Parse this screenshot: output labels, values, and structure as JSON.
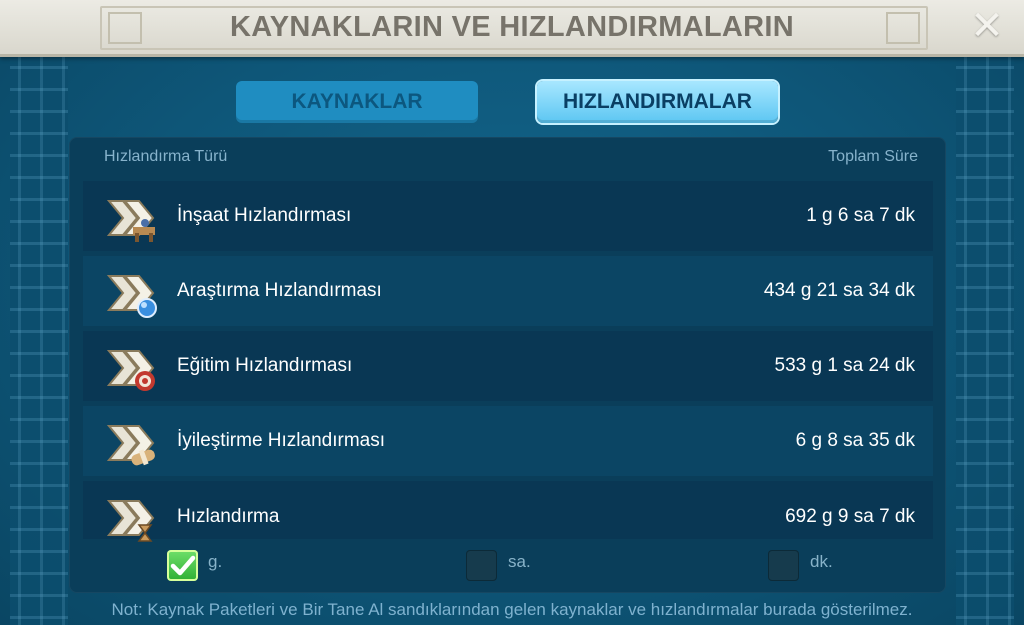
{
  "window": {
    "title": "KAYNAKLARIN VE HIZLANDIRMALARIN",
    "close_label": "✕"
  },
  "tabs": [
    {
      "label": "KAYNAKLAR",
      "active": false
    },
    {
      "label": "HIZLANDIRMALAR",
      "active": true
    }
  ],
  "table": {
    "columns": {
      "type": "Hızlandırma Türü",
      "total": "Toplam Süre"
    },
    "rows": [
      {
        "name": "İnşaat Hızlandırması",
        "total": "1 g 6 sa 7 dk",
        "icon": "construction-speedup-icon"
      },
      {
        "name": "Araştırma Hızlandırması",
        "total": "434 g 21 sa 34 dk",
        "icon": "research-speedup-icon"
      },
      {
        "name": "Eğitim Hızlandırması",
        "total": "533 g 1 sa 24 dk",
        "icon": "training-speedup-icon"
      },
      {
        "name": "İyileştirme Hızlandırması",
        "total": "6 g 8 sa 35 dk",
        "icon": "healing-speedup-icon"
      },
      {
        "name": "Hızlandırma",
        "total": "692 g 9 sa 7 dk",
        "icon": "universal-speedup-icon"
      }
    ]
  },
  "units": [
    {
      "label": "g.",
      "checked": true
    },
    {
      "label": "sa.",
      "checked": false
    },
    {
      "label": "dk.",
      "checked": false
    }
  ],
  "note": "Not: Kaynak Paketleri ve Bir Tane Al sandıklarından gelen kaynaklar ve hızlandırmalar burada gösterilmez.",
  "colors": {
    "background": "#0f5273",
    "panel": "#0a3e5a",
    "active_tab": "#5cc6f2",
    "check_green": "#2eae33"
  }
}
